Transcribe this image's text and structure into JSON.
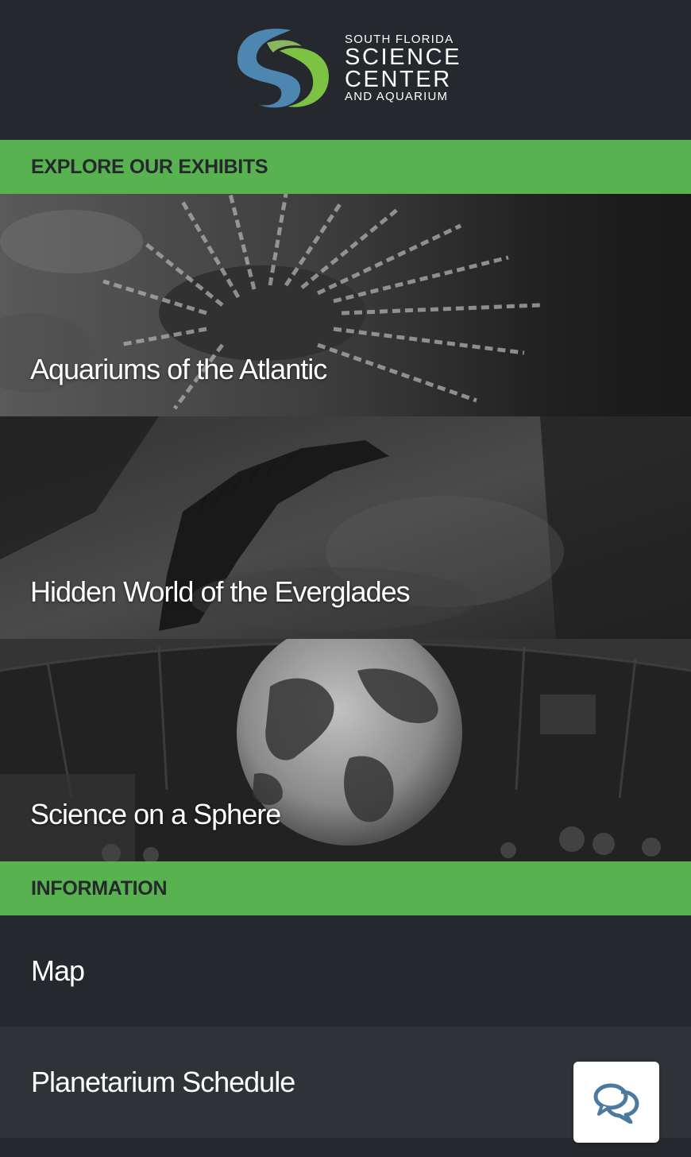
{
  "brand": {
    "line1": "SOUTH FLORIDA",
    "line2": "SCIENCE",
    "line3": "CENTER",
    "line4": "AND AQUARIUM",
    "colors": {
      "blue": "#4d86b0",
      "green": "#7dc242",
      "accent_green": "#58b24f"
    }
  },
  "sections": {
    "exhibits_heading": "EXPLORE OUR EXHIBITS",
    "information_heading": "INFORMATION"
  },
  "exhibits": [
    {
      "label": "Aquariums of the Atlantic",
      "image": "lionfish-photo"
    },
    {
      "label": "Hidden World of the Everglades",
      "image": "alligator-photo"
    },
    {
      "label": "Science on a Sphere",
      "image": "globe-sphere-photo"
    }
  ],
  "information": [
    {
      "label": "Map"
    },
    {
      "label": "Planetarium Schedule"
    }
  ],
  "chat": {
    "icon": "chat-bubbles-icon",
    "color": "#4a7aa0"
  }
}
